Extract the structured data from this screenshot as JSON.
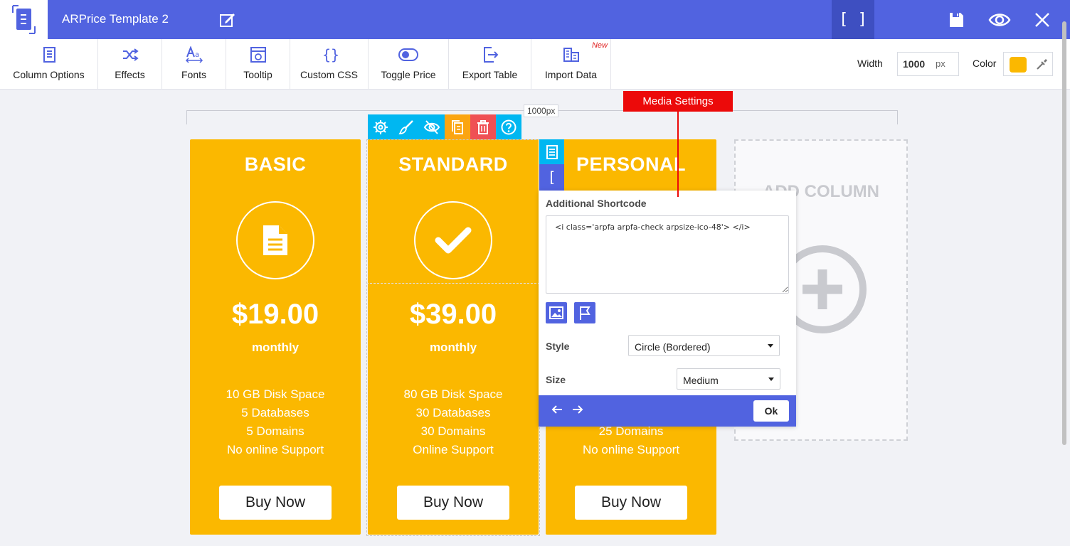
{
  "app": {
    "title": "ARPrice Template 2",
    "shortcode_button": "[ ]"
  },
  "toolbar": {
    "items": [
      {
        "label": "Column Options",
        "icon": "column-options-icon"
      },
      {
        "label": "Effects",
        "icon": "shuffle-icon"
      },
      {
        "label": "Fonts",
        "icon": "fonts-icon"
      },
      {
        "label": "Tooltip",
        "icon": "tooltip-icon"
      },
      {
        "label": "Custom CSS",
        "icon": "braces-icon"
      },
      {
        "label": "Toggle Price",
        "icon": "toggle-icon"
      },
      {
        "label": "Export Table",
        "icon": "export-icon"
      },
      {
        "label": "Import Data",
        "icon": "import-icon",
        "badge": "New"
      }
    ],
    "width_label": "Width",
    "width_value": "1000",
    "width_unit": "px",
    "color_label": "Color",
    "color_value": "#fbb800"
  },
  "canvas": {
    "ruler_label": "1000px"
  },
  "columns": [
    {
      "title": "BASIC",
      "icon": "document-icon",
      "price": "$19.00",
      "period": "monthly",
      "features": [
        "10 GB Disk Space",
        "5 Databases",
        "5 Domains",
        "No online Support"
      ],
      "button": "Buy Now"
    },
    {
      "title": "STANDARD",
      "icon": "check-icon",
      "price": "$39.00",
      "period": "monthly",
      "features": [
        "80 GB Disk Space",
        "30 Databases",
        "30 Domains",
        "Online Support"
      ],
      "button": "Buy Now"
    },
    {
      "title": "PERSONAL",
      "features": [
        "25 Domains",
        "No online Support"
      ],
      "button": "Buy Now"
    }
  ],
  "add_column": {
    "label": "ADD COLUMN"
  },
  "popup": {
    "heading": "Additional Shortcode",
    "shortcode": "<i class='arpfa arpfa-check arpsize-ico-48'> </i>",
    "style_label": "Style",
    "style_value": "Circle (Bordered)",
    "size_label": "Size",
    "size_value": "Medium",
    "ok": "Ok",
    "side_tab": "[ ]"
  },
  "tooltip": {
    "label": "Media Settings"
  },
  "colors": {
    "brand": "#5163e0",
    "accent": "#fbb800",
    "cyan": "#00b7f1",
    "red": "#ec0a0a"
  }
}
